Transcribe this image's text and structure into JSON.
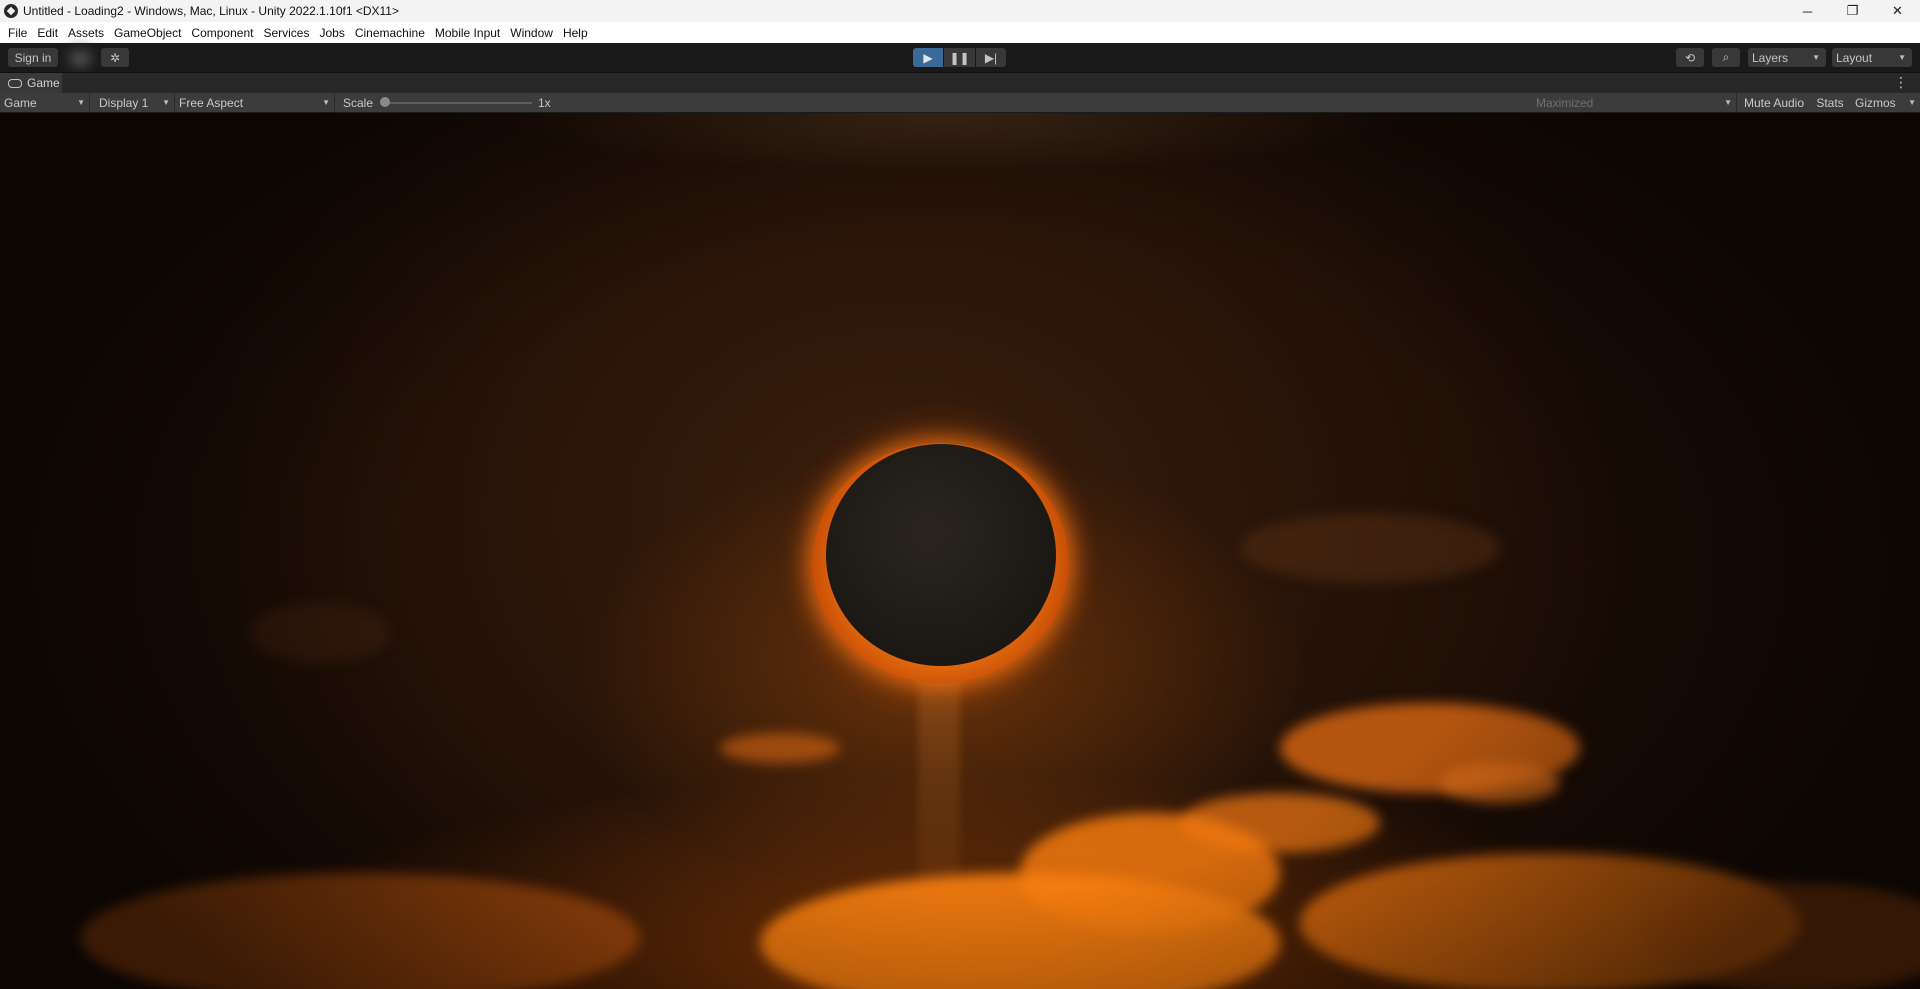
{
  "window": {
    "title": "Untitled - Loading2 - Windows, Mac, Linux - Unity 2022.1.10f1 <DX11>",
    "controls": {
      "minimize": "─",
      "restore": "❐",
      "close": "✕"
    }
  },
  "menu": [
    "File",
    "Edit",
    "Assets",
    "GameObject",
    "Component",
    "Services",
    "Jobs",
    "Cinemachine",
    "Mobile Input",
    "Window",
    "Help"
  ],
  "toolbar": {
    "sign_in": "Sign in",
    "cloud_icon": "☁",
    "collab_icon": "✲",
    "play_icon": "▶",
    "pause_icon": "❚❚",
    "step_icon": "▶|",
    "history_icon": "⟲",
    "search_icon": "⌕",
    "layers": "Layers",
    "layout": "Layout",
    "caret": "▼"
  },
  "panel": {
    "tab": "Game",
    "menu_icon": "⋮"
  },
  "game_view": {
    "mode": "Game",
    "display": "Display 1",
    "aspect": "Free Aspect",
    "scale_label": "Scale",
    "scale_value": "1x",
    "maximized": "Maximized",
    "mute_audio": "Mute Audio",
    "stats": "Stats",
    "gizmos": "Gizmos"
  },
  "colors": {
    "play_active": "#3a6a98",
    "toolbar_bg": "#191919",
    "sky_dark": "#1a0c05",
    "corona": "#ff8a1a"
  }
}
